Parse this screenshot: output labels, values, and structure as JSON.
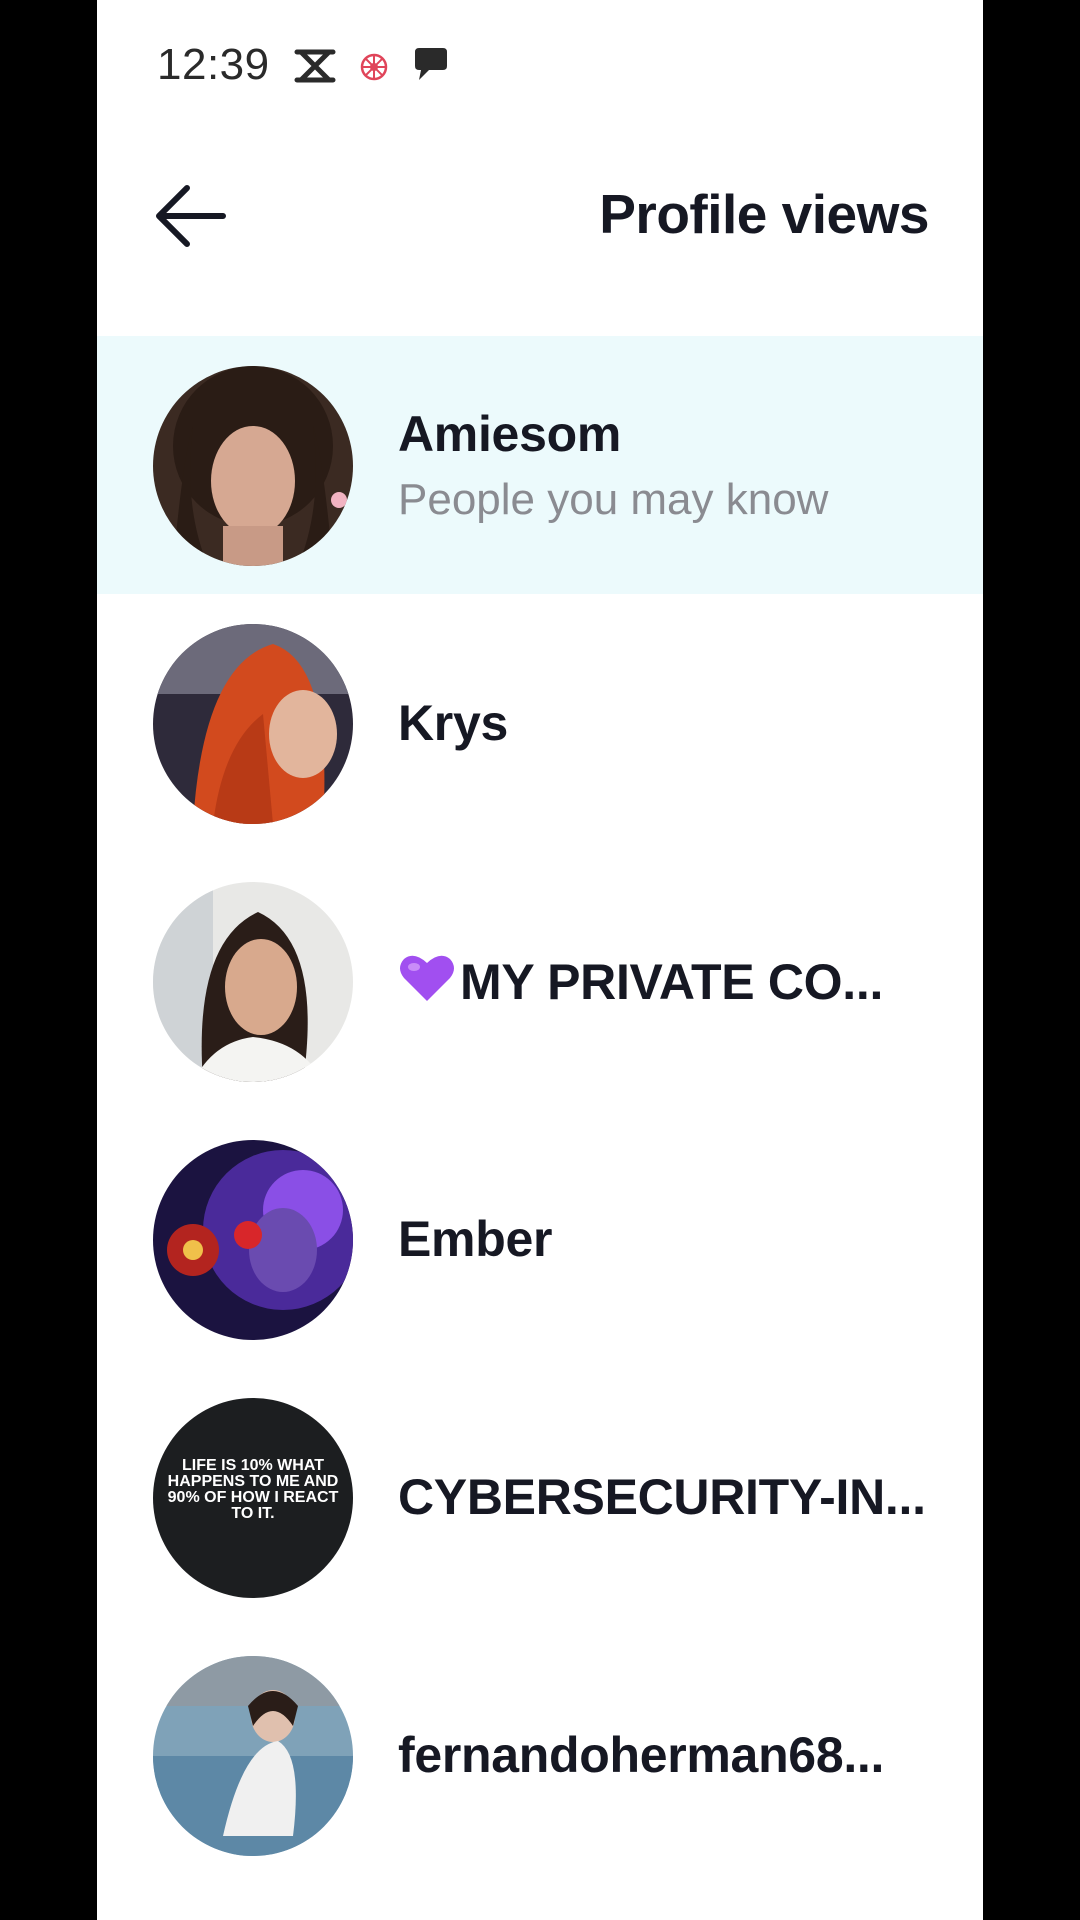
{
  "status_bar": {
    "time": "12:39",
    "icons": [
      "capcut-icon",
      "flower-icon",
      "chat-bubble-icon"
    ]
  },
  "header": {
    "back_icon": "arrow-left-icon",
    "title": "Profile views"
  },
  "viewers": [
    {
      "name": "Amiesom",
      "subtitle": "People you may know",
      "highlighted": true
    },
    {
      "name": "Krys",
      "subtitle": "",
      "highlighted": false
    },
    {
      "name": "MY PRIVATE CO...",
      "prefix_icon": "purple-heart-icon",
      "subtitle": "",
      "highlighted": false
    },
    {
      "name": "Ember",
      "subtitle": "",
      "highlighted": false
    },
    {
      "name": "CYBERSECURITY-IN...",
      "subtitle": "",
      "highlighted": false,
      "avatar_text": "LIFE IS 10% WHAT HAPPENS TO ME AND 90% OF HOW I REACT TO IT."
    },
    {
      "name": "fernandoherman68...",
      "subtitle": "",
      "highlighted": false
    }
  ],
  "colors": {
    "highlight_row": "#ecfafc",
    "title_text": "#161823",
    "subtitle_text": "#8a8b91",
    "heart": "#a14ff0"
  }
}
